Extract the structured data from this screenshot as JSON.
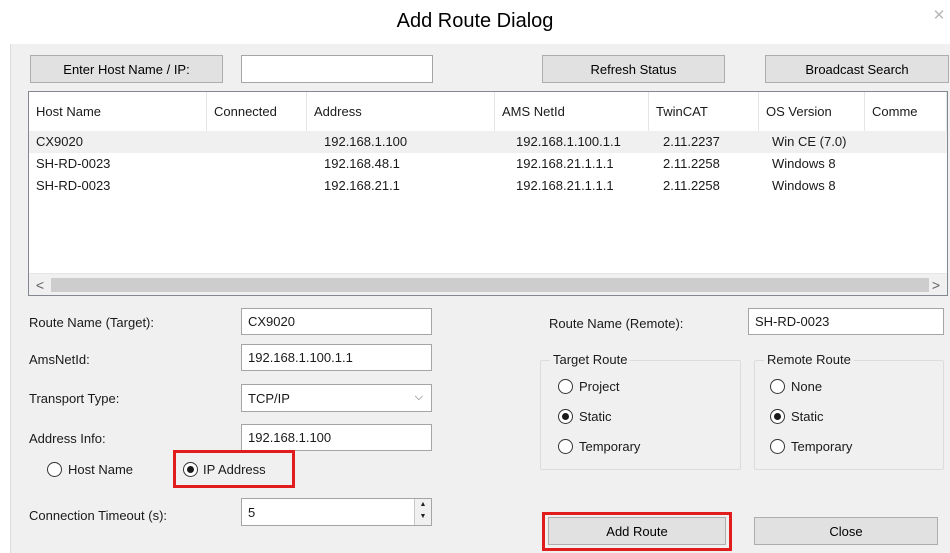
{
  "window": {
    "title": "Add Route Dialog",
    "close_glyph": "✕"
  },
  "toolbar": {
    "enter_host_label": "Enter Host Name / IP:",
    "host_value": "",
    "refresh_label": "Refresh Status",
    "broadcast_label": "Broadcast Search"
  },
  "table": {
    "columns": [
      "Host Name",
      "Connected",
      "Address",
      "AMS NetId",
      "TwinCAT",
      "OS Version",
      "Comme"
    ],
    "rows": [
      [
        "CX9020",
        "",
        "192.168.1.100",
        "192.168.1.100.1.1",
        "2.11.2237",
        "Win CE (7.0)",
        ""
      ],
      [
        "SH-RD-0023",
        "",
        "192.168.48.1",
        "192.168.21.1.1.1",
        "2.11.2258",
        "Windows 8",
        ""
      ],
      [
        "SH-RD-0023",
        "",
        "192.168.21.1",
        "192.168.21.1.1.1",
        "2.11.2258",
        "Windows 8",
        ""
      ]
    ],
    "selected_row": 0,
    "scroll_left": "<",
    "scroll_right": ">"
  },
  "form": {
    "route_name_label": "Route Name (Target):",
    "route_name_value": "CX9020",
    "amsnetid_label": "AmsNetId:",
    "amsnetid_value": "192.168.1.100.1.1",
    "transport_label": "Transport Type:",
    "transport_value": "TCP/IP",
    "address_info_label": "Address Info:",
    "address_info_value": "192.168.1.100",
    "host_name_radio": "Host Name",
    "ip_address_radio": "IP Address",
    "address_mode_selected": "IP Address",
    "timeout_label": "Connection Timeout (s):",
    "timeout_value": "5",
    "remote_route_name_label": "Route Name (Remote):",
    "remote_route_name_value": "SH-RD-0023"
  },
  "target_route": {
    "title": "Target Route",
    "options": [
      "Project",
      "Static",
      "Temporary"
    ],
    "selected": "Static"
  },
  "remote_route": {
    "title": "Remote Route",
    "options": [
      "None",
      "Static",
      "Temporary"
    ],
    "selected": "Static"
  },
  "actions": {
    "add_route_label": "Add Route",
    "close_label": "Close"
  },
  "colors": {
    "highlight": "#e11c1c",
    "dialog_bg": "#f0f0f0",
    "button_bg": "#e1e1e1"
  }
}
